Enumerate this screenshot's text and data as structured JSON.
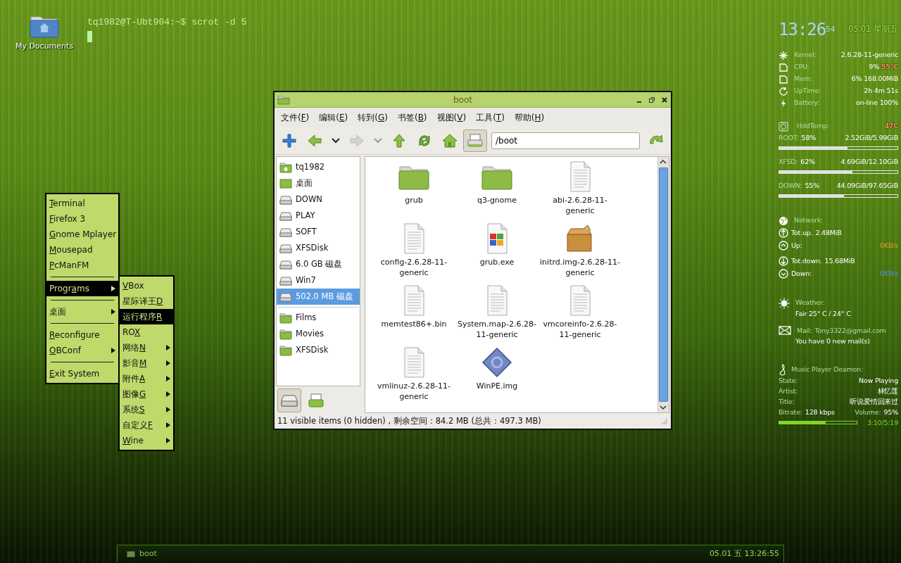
{
  "desktop_icon": {
    "label": "My Documents"
  },
  "terminal": {
    "prompt": "tq1982@T-Ubt904:~$ scrot -d 5"
  },
  "menu": {
    "items": [
      {
        "kind": "item",
        "accel": "T",
        "rest": "erminal",
        "submenu": false,
        "selected": false
      },
      {
        "kind": "item",
        "accel": "F",
        "rest": "irefox 3",
        "submenu": false,
        "selected": false
      },
      {
        "kind": "item",
        "accel": "G",
        "rest": "nome Mplayer",
        "submenu": false,
        "selected": false
      },
      {
        "kind": "item",
        "accel": "M",
        "rest": "ousepad",
        "submenu": false,
        "selected": false
      },
      {
        "kind": "item",
        "accel": "P",
        "rest": "cManFM",
        "submenu": false,
        "selected": false
      },
      {
        "kind": "separator"
      },
      {
        "kind": "item",
        "prefix": "Progr",
        "accel": "a",
        "rest": "ms",
        "submenu": true,
        "selected": true
      },
      {
        "kind": "separator"
      },
      {
        "kind": "item",
        "prefix": "桌面",
        "submenu": true,
        "selected": false
      },
      {
        "kind": "separator"
      },
      {
        "kind": "item",
        "accel": "R",
        "rest": "econfigure",
        "submenu": false,
        "selected": false
      },
      {
        "kind": "item",
        "accel": "O",
        "rest": "BConf",
        "submenu": true,
        "selected": false
      },
      {
        "kind": "separator"
      },
      {
        "kind": "item",
        "accel": "E",
        "rest": "xit System",
        "submenu": false,
        "selected": false
      }
    ]
  },
  "submenu": {
    "items": [
      {
        "kind": "item",
        "accel": "V",
        "rest": "Box",
        "submenu": false,
        "selected": false
      },
      {
        "kind": "item",
        "prefix": "星际译王",
        "accel": "D",
        "submenu": false,
        "selected": false
      },
      {
        "kind": "item",
        "prefix": "运行程序",
        "accel": "R",
        "submenu": false,
        "selected": true
      },
      {
        "kind": "item",
        "prefix": "RO",
        "accel": "X",
        "submenu": false,
        "selected": false
      },
      {
        "kind": "item",
        "prefix": "网络",
        "accel": "N",
        "submenu": true,
        "selected": false
      },
      {
        "kind": "item",
        "prefix": "影音",
        "accel": "M",
        "submenu": true,
        "selected": false
      },
      {
        "kind": "item",
        "prefix": "附件",
        "accel": "A",
        "submenu": true,
        "selected": false
      },
      {
        "kind": "item",
        "prefix": "图像",
        "accel": "G",
        "submenu": true,
        "selected": false
      },
      {
        "kind": "item",
        "prefix": "系统",
        "accel": "S",
        "submenu": true,
        "selected": false
      },
      {
        "kind": "item",
        "prefix": "自定义",
        "accel": "F",
        "submenu": true,
        "selected": false
      },
      {
        "kind": "item",
        "accel": "W",
        "rest": "ine",
        "submenu": true,
        "selected": false
      }
    ]
  },
  "file_manager": {
    "title": "boot",
    "menubar": [
      {
        "prefix": "文件(",
        "accel": "F",
        "rest": ")"
      },
      {
        "prefix": "编辑(",
        "accel": "E",
        "rest": ")"
      },
      {
        "prefix": "转到(",
        "accel": "G",
        "rest": ")"
      },
      {
        "prefix": "书签(",
        "accel": "B",
        "rest": ")"
      },
      {
        "prefix": "视图(",
        "accel": "V",
        "rest": ")"
      },
      {
        "prefix": "工具(",
        "accel": "T",
        "rest": ")"
      },
      {
        "prefix": "帮助(",
        "accel": "H",
        "rest": ")"
      }
    ],
    "toolbar": [
      {
        "kind": "add",
        "disabled": false,
        "pressed": false
      },
      {
        "kind": "back",
        "disabled": false,
        "pressed": false
      },
      {
        "kind": "history",
        "disabled": false,
        "pressed": false
      },
      {
        "kind": "forward",
        "disabled": true,
        "pressed": false
      },
      {
        "kind": "history",
        "disabled": true,
        "pressed": false
      },
      {
        "kind": "up",
        "disabled": false,
        "pressed": false
      },
      {
        "kind": "reload",
        "disabled": false,
        "pressed": false
      },
      {
        "kind": "home",
        "disabled": false,
        "pressed": false
      },
      {
        "kind": "drive",
        "disabled": false,
        "pressed": true
      }
    ],
    "location": {
      "value": "/boot"
    },
    "places": [
      {
        "label": "tq1982",
        "kind": "home",
        "selected": false
      },
      {
        "label": "桌面",
        "kind": "desktop",
        "selected": false
      },
      {
        "label": "DOWN",
        "kind": "drive",
        "selected": false
      },
      {
        "label": "PLAY",
        "kind": "drive",
        "selected": false
      },
      {
        "label": "SOFT",
        "kind": "drive",
        "selected": false
      },
      {
        "label": "XFSDisk",
        "kind": "drive",
        "selected": false
      },
      {
        "label": "6.0 GB 磁盘",
        "kind": "drive",
        "selected": false
      },
      {
        "label": "Win7",
        "kind": "drive",
        "selected": false
      },
      {
        "label": "502.0 MB 磁盘",
        "kind": "drive",
        "selected": true
      }
    ],
    "bookmarks": [
      {
        "label": "Films",
        "kind": "folder",
        "selected": false
      },
      {
        "label": "Movies",
        "kind": "folder",
        "selected": false
      },
      {
        "label": "XFSDisk",
        "kind": "folder",
        "selected": false
      }
    ],
    "side_tabs": [
      {
        "kind": "places",
        "selected": true
      },
      {
        "kind": "tree",
        "selected": false
      }
    ],
    "files": [
      {
        "label": "grub",
        "kind": "folder"
      },
      {
        "label": "q3-gnome",
        "kind": "folder"
      },
      {
        "label": "abi-2.6.28-11-generic",
        "kind": "text"
      },
      {
        "label": "config-2.6.28-11-generic",
        "kind": "text"
      },
      {
        "label": "grub.exe",
        "kind": "exe"
      },
      {
        "label": "initrd.img-2.6.28-11-generic",
        "kind": "package"
      },
      {
        "label": "memtest86+.bin",
        "kind": "text"
      },
      {
        "label": "System.map-2.6.28-11-generic",
        "kind": "text"
      },
      {
        "label": "vmcoreinfo-2.6.28-11-generic",
        "kind": "text"
      },
      {
        "label": "vmlinuz-2.6.28-11-generic",
        "kind": "text"
      },
      {
        "label": "WinPE.img",
        "kind": "image"
      }
    ],
    "status_bar": "11 visible items (0 hidden) , 剩余空间：84.2 MB (总共：497.3 MB)"
  },
  "conky": {
    "clock": {
      "time": "13:26",
      "seconds": "54",
      "date": "05.01 星期五"
    },
    "system": [
      {
        "kind": "kernel",
        "label": "Kernel:",
        "value": "2.6.28-11-generic"
      },
      {
        "kind": "cpu",
        "label": "CPU:",
        "value": "9%",
        "temp": "55°C"
      },
      {
        "kind": "memory",
        "label": "Mem:",
        "value": "6% 168.00MiB"
      },
      {
        "kind": "uptime",
        "label": "UpTime:",
        "value": "2h 4m 51s"
      },
      {
        "kind": "battery",
        "label": "Battery:",
        "value": "on-line 100%"
      }
    ],
    "hdd": {
      "label": "HddTemp:",
      "value": "47C"
    },
    "disks": [
      {
        "label": "ROOT:",
        "percent": "58%",
        "usage": "2.52GiB/5.99GiB",
        "level": 0.58
      },
      {
        "label": "XFSD:",
        "percent": "62%",
        "usage": "4.69GiB/12.10GiB",
        "level": 0.62
      },
      {
        "label": "DOWN:",
        "percent": "55%",
        "usage": "44.09GiB/97.65GiB",
        "level": 0.55
      }
    ],
    "network": {
      "label": "Network:",
      "rows": [
        {
          "kind": "total-up",
          "label": "Tot.up.",
          "value": "2.48MiB",
          "color": "#ffffff"
        },
        {
          "kind": "up",
          "label": "Up:",
          "value": "0KB/s",
          "color": "#f0962a"
        },
        {
          "kind": "total-down",
          "label": "Tot.down.",
          "value": "15.68MiB",
          "color": "#ffffff"
        },
        {
          "kind": "down",
          "label": "Down:",
          "value": "0KB/s",
          "color": "#5b8fe6"
        }
      ]
    },
    "weather": {
      "label": "Weather:",
      "text": "Fair 25° C / 24° C"
    },
    "mail": {
      "label": "Mail:",
      "address": "Tony3322@gmail.com",
      "text": "You have 0 new mail(s)"
    },
    "music": {
      "label": "Music Player Deamon:",
      "rows": [
        {
          "label": "State:",
          "value": "Now Playing"
        },
        {
          "label": "Artist:",
          "value": "林忆莲"
        },
        {
          "label": "Title:",
          "value": "听说爱情回来过"
        }
      ],
      "bitrate_label": "Bitrate:",
      "bitrate": "128 kbps",
      "volume_label": "Volume:",
      "volume": "95%",
      "level": 0.6,
      "position": "3:10/5:19"
    }
  },
  "taskbar": {
    "tasks": [
      {
        "label": "boot",
        "selected": false
      }
    ],
    "clock": "05.01 五 13:26:55"
  }
}
